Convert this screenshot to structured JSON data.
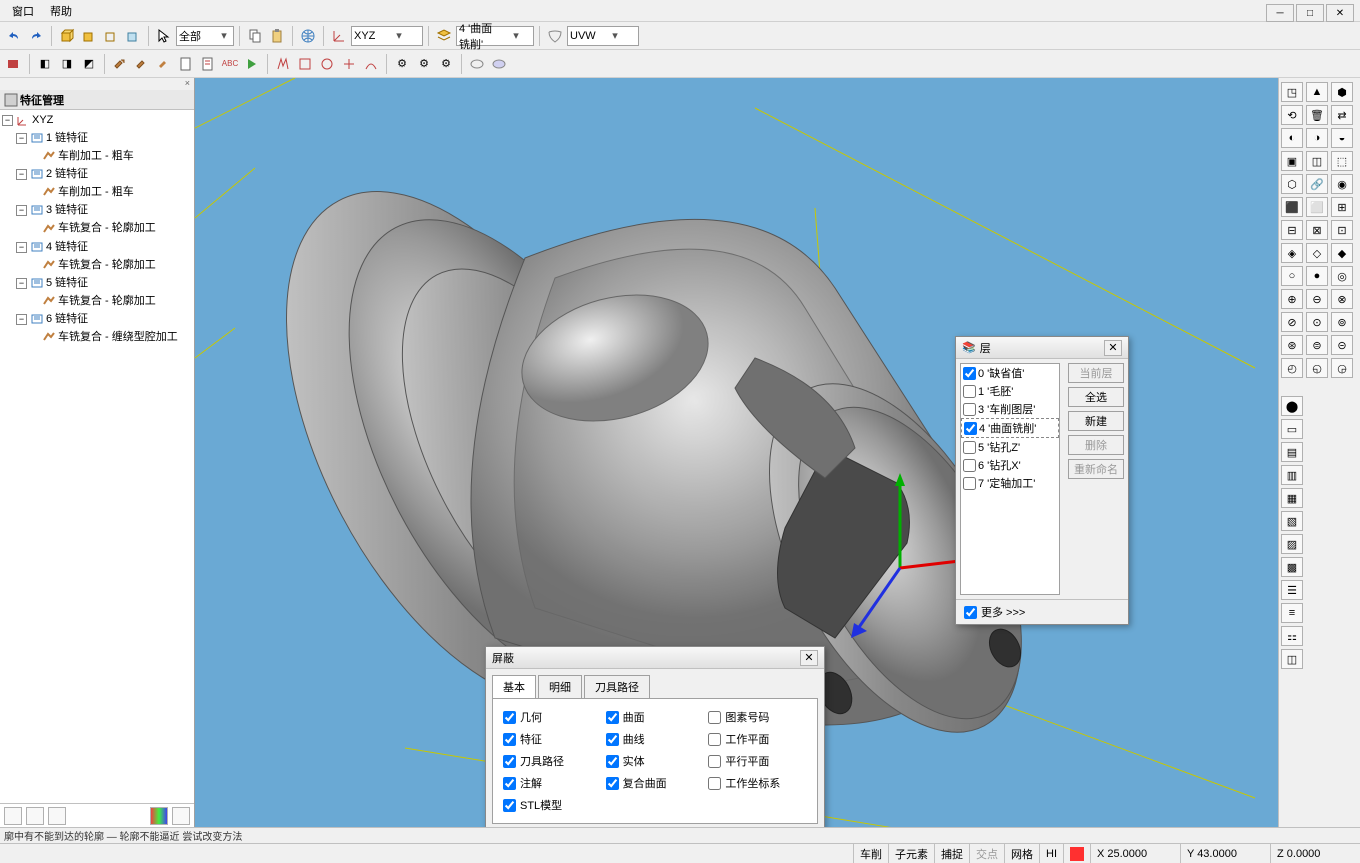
{
  "menu": {
    "window": "窗口",
    "help": "帮助"
  },
  "window_controls": {
    "min": "─",
    "max": "□",
    "close": "✕"
  },
  "toolbar": {
    "select_all": "全部",
    "coord_sys": "XYZ",
    "layer_combo": "4 '曲面铣削'",
    "uvw": "UVW"
  },
  "tree": {
    "title": "特征管理",
    "root": "XYZ",
    "nodes": [
      {
        "label": "1 链特征",
        "child": "车削加工 - 粗车"
      },
      {
        "label": "2 链特征",
        "child": "车削加工 - 粗车"
      },
      {
        "label": "3 链特征",
        "child": "车铣复合 - 轮廓加工"
      },
      {
        "label": "4 链特征",
        "child": "车铣复合 - 轮廓加工"
      },
      {
        "label": "5 链特征",
        "child": "车铣复合 - 轮廓加工"
      },
      {
        "label": "6 链特征",
        "child": "车铣复合 - 缠绕型腔加工"
      }
    ]
  },
  "layers": {
    "title": "层",
    "items": [
      {
        "checked": true,
        "label": "0 '缺省值'"
      },
      {
        "checked": false,
        "label": "1 '毛胚'"
      },
      {
        "checked": false,
        "label": "3 '车削图层'"
      },
      {
        "checked": true,
        "label": "4 '曲面铣削'",
        "selected": true
      },
      {
        "checked": false,
        "label": "5 '钻孔Z'"
      },
      {
        "checked": false,
        "label": "6 '钻孔X'"
      },
      {
        "checked": false,
        "label": "7 '定轴加工'"
      }
    ],
    "buttons": {
      "current": "当前层",
      "select_all": "全选",
      "new": "新建",
      "delete": "删除",
      "rename": "重新命名"
    },
    "more": "更多 >>>"
  },
  "mask": {
    "title": "屏蔽",
    "tabs": {
      "basic": "基本",
      "detail": "明细",
      "toolpath": "刀具路径"
    },
    "checks": {
      "geometry": "几何",
      "surface": "曲面",
      "element_id": "图素号码",
      "feature": "特征",
      "curve": "曲线",
      "workplane": "工作平面",
      "toolpath": "刀具路径",
      "solid": "实体",
      "parallel_plane": "平行平面",
      "annotation": "注解",
      "comp_surface": "复合曲面",
      "wcs": "工作坐标系",
      "stl": "STL模型"
    }
  },
  "small_status": "廓中有不能到达的轮廓 — 轮廓不能逼近    尝试改变方法",
  "status": {
    "mode1": "车削",
    "mode2": "子元素",
    "snap": "捕捉",
    "intersect": "交点",
    "grid": "网格",
    "hi": "HI",
    "x": "X 25.0000",
    "y": "Y 43.0000",
    "z": "Z 0.0000"
  }
}
